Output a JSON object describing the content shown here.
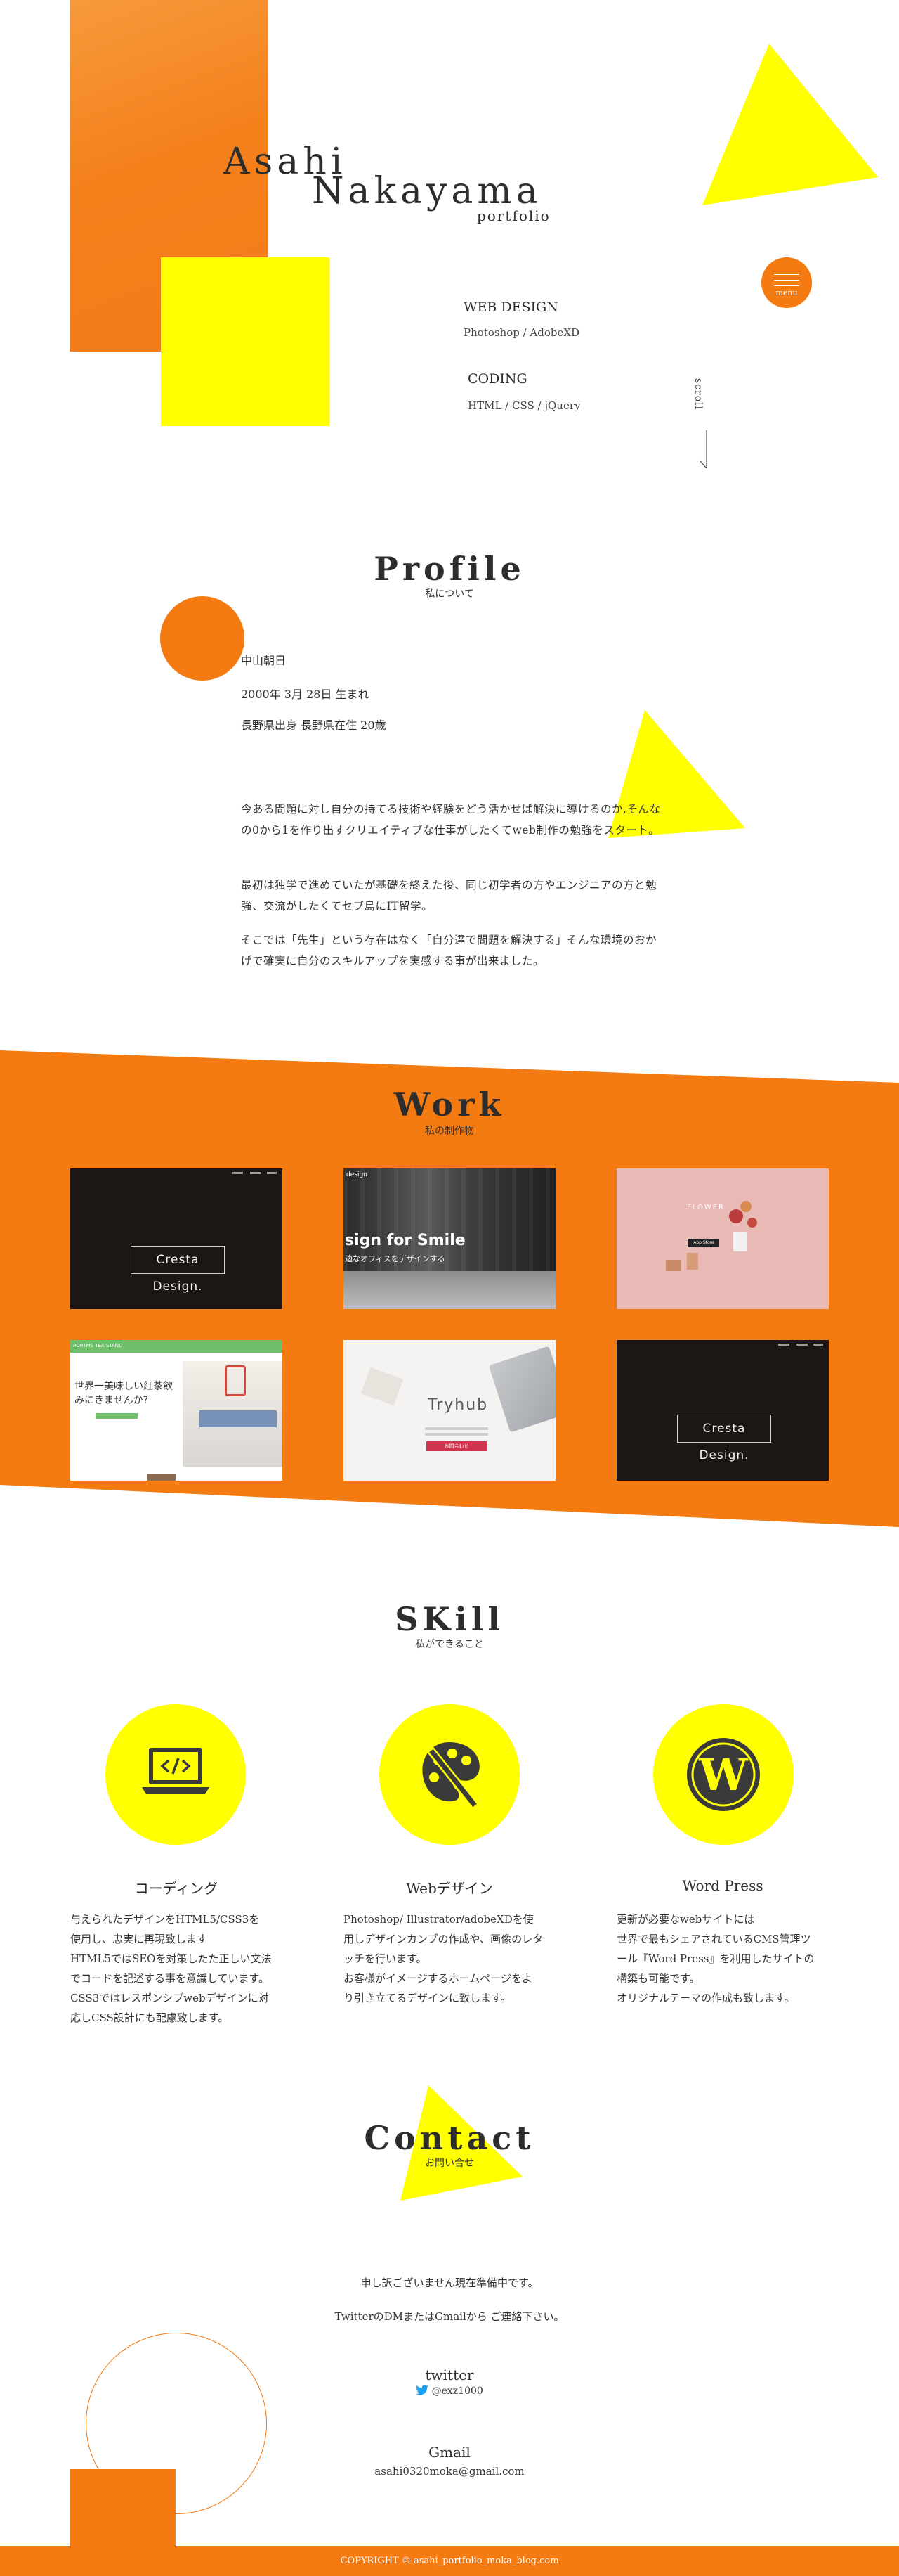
{
  "hero": {
    "first_name": "Asahi",
    "last_name": "Nakayama",
    "subtitle": "portfolio",
    "menu_label": "menu",
    "services": [
      {
        "title": "WEB DESIGN",
        "tools": "Photoshop / AdobeXD"
      },
      {
        "title": "CODING",
        "tools": "HTML / CSS / jQuery"
      }
    ],
    "scroll_label": "scroll"
  },
  "profile": {
    "title": "Profile",
    "subtitle": "私について",
    "name": "中山朝日",
    "birth": "2000年 3月 28日 生まれ",
    "origin": "長野県出身 長野県在住 20歳",
    "paragraphs": [
      "今ある問題に対し自分の持てる技術や経験をどう活かせば解決に導けるのか,そんなの0から1を作り出すクリエイティブな仕事がしたくてweb制作の勉強をスタート。",
      "最初は独学で進めていたが基礎を終えた後、同じ初学者の方やエンジニアの方と勉強、交流がしたくてセブ島にIT留学。",
      "そこでは「先生」という存在はなく「自分達で問題を解決する」そんな環境のおかげで確実に自分のスキルアップを実感する事が出来ました。"
    ]
  },
  "work": {
    "title": "Work",
    "subtitle": "私の制作物",
    "cards": [
      {
        "label": "Cresta Design."
      },
      {
        "label": "sign for Smile",
        "sub": "適なオフィスをデザインする",
        "brand": "design"
      },
      {
        "label": "FLOWER",
        "sub": "App Store"
      },
      {
        "label": "世界一美味しい紅茶飲みにきませんか?",
        "brand": "PORTMS TEA STAND"
      },
      {
        "label": "Tryhub",
        "sub": "お問合わせ"
      },
      {
        "label": "Cresta Design."
      }
    ]
  },
  "skill": {
    "title": "SKill",
    "subtitle": "私ができること",
    "items": [
      {
        "name": "コーディング",
        "icon": "laptop-code-icon",
        "desc": [
          "与えられたデザインをHTML5/CSS3を",
          "使用し、忠実に再現致します",
          "HTML5ではSEOを対策したた正しい文法",
          "でコードを記述する事を意識しています。",
          "CSS3ではレスポンシブwebデザインに対",
          "応しCSS設計にも配慮致します。"
        ]
      },
      {
        "name": "Webデザイン",
        "icon": "palette-brush-icon",
        "desc": [
          "Photoshop/ Illustrator/adobeXDを使",
          "用しデザインカンプの作成や、画像のレタ",
          "ッチを行います。",
          "お客様がイメージするホームページをよ",
          "り引き立てるデザインに致します。"
        ]
      },
      {
        "name": "Word Press",
        "icon": "wordpress-icon",
        "desc": [
          "更新が必要なwebサイトには",
          "世界で最もシェアされているCMS管理ツ",
          "ール『Word Press』を利用したサイトの",
          "構築も可能です。",
          "オリジナルテーマの作成も致します。"
        ]
      }
    ]
  },
  "contact": {
    "title": "Contact",
    "subtitle": "お問い合せ",
    "note1": "申し訳ございません現在準備中です。",
    "note2": "TwitterのDMまたはGmailから ご連絡下さい。",
    "twitter_label": "twitter",
    "twitter_handle": "@exz1000",
    "gmail_label": "Gmail",
    "gmail_address": "asahi0320moka@gmail.com"
  },
  "footer": {
    "copyright": "COPYRIGHT © asahi_portfolio_moka_blog.com"
  },
  "colors": {
    "orange": "#f47a12",
    "yellow": "#ffff00",
    "text": "#2d2d2d"
  }
}
